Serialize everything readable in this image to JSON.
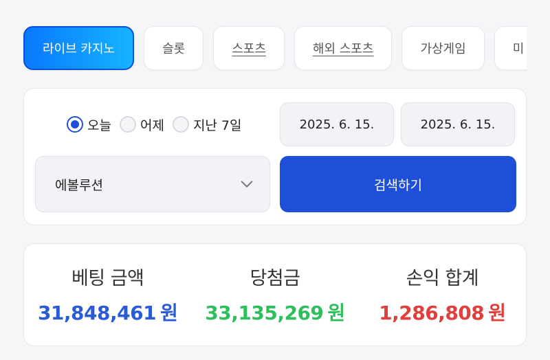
{
  "tabs": [
    {
      "label": "라이브 카지노"
    },
    {
      "label": "슬롯"
    },
    {
      "label": "스포츠"
    },
    {
      "label": "해외 스포츠"
    },
    {
      "label": "가상게임"
    },
    {
      "label": "미"
    }
  ],
  "filter": {
    "radios": [
      {
        "label": "오늘",
        "checked": true
      },
      {
        "label": "어제",
        "checked": false
      },
      {
        "label": "지난 7일",
        "checked": false
      }
    ],
    "date_start": "2025. 6. 15.",
    "date_end": "2025. 6. 15.",
    "provider_select": "에볼루션",
    "search_button": "검색하기"
  },
  "summary": {
    "bet_label": "베팅 금액",
    "bet_value": "31,848,461",
    "win_label": "당첨금",
    "win_value": "33,135,269",
    "profit_label": "손익 합계",
    "profit_value": "1,286,808",
    "currency_unit": "원"
  },
  "colors": {
    "primary": "#1e4fd8",
    "bet": "#2a5bd7",
    "win": "#2ebf5c",
    "profit": "#e0403c"
  },
  "icons": {
    "select_arrow": "chevron-down-icon"
  }
}
